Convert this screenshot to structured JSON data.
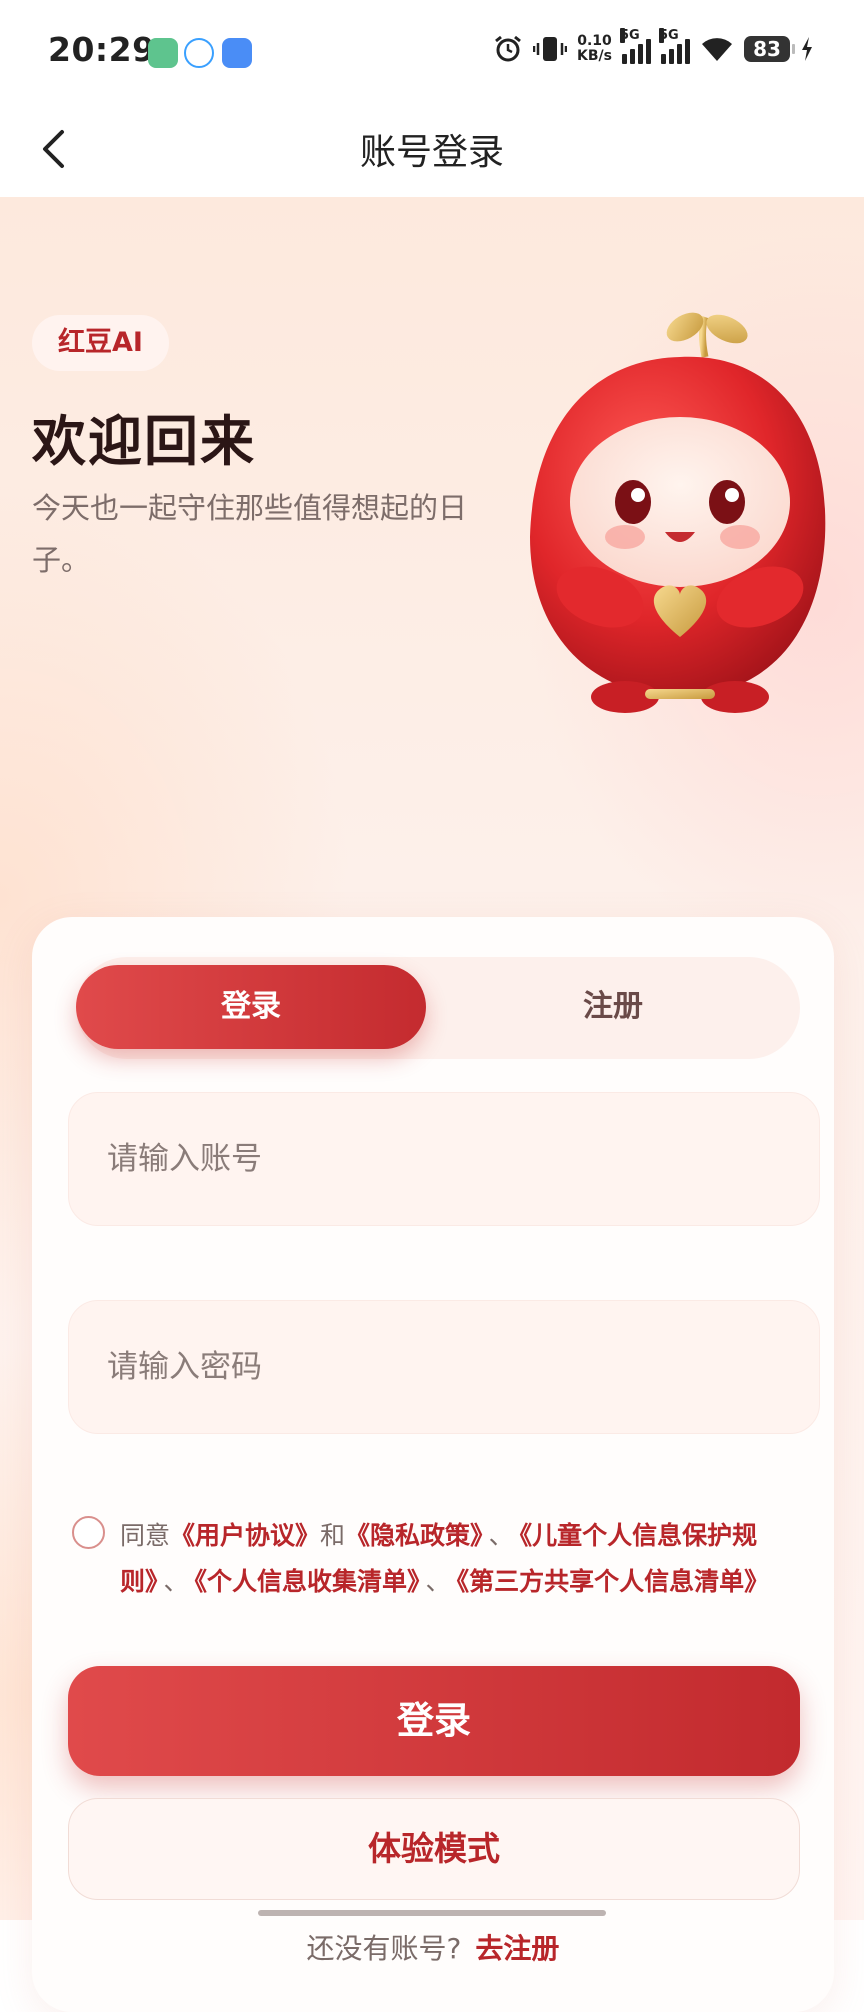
{
  "status_bar": {
    "time": "20:29",
    "net_rate_value": "0.10",
    "net_rate_unit": "KB/s",
    "signal1_label": "5G",
    "signal2_label": "5G",
    "battery": "83"
  },
  "header": {
    "title": "账号登录"
  },
  "hero": {
    "brand_badge": "红豆AI",
    "welcome_title": "欢迎回来",
    "slogan": "今天也一起守住那些值得想起的日子。"
  },
  "auth_tabs": {
    "login": "登录",
    "register": "注册",
    "active": "login"
  },
  "form": {
    "account_placeholder": "请输入账号",
    "password_placeholder": "请输入密码"
  },
  "agreement": {
    "prefix": "同意",
    "user_agreement": "《用户协议》",
    "and": "和",
    "privacy_policy": "《隐私政策》",
    "separator": "、",
    "child_privacy": "《儿童个人信息保护规则》",
    "info_collection": "《个人信息收集清单》",
    "third_party": "《第三方共享个人信息清单》",
    "checked": false
  },
  "actions": {
    "login_button": "登录",
    "trial_button": "体验模式",
    "no_account_text": "还没有账号?",
    "go_register_link": "去注册"
  },
  "colors": {
    "brand_red": "#c42b2f",
    "link_red": "#b8262a",
    "bg_peach": "#fde9dd"
  }
}
